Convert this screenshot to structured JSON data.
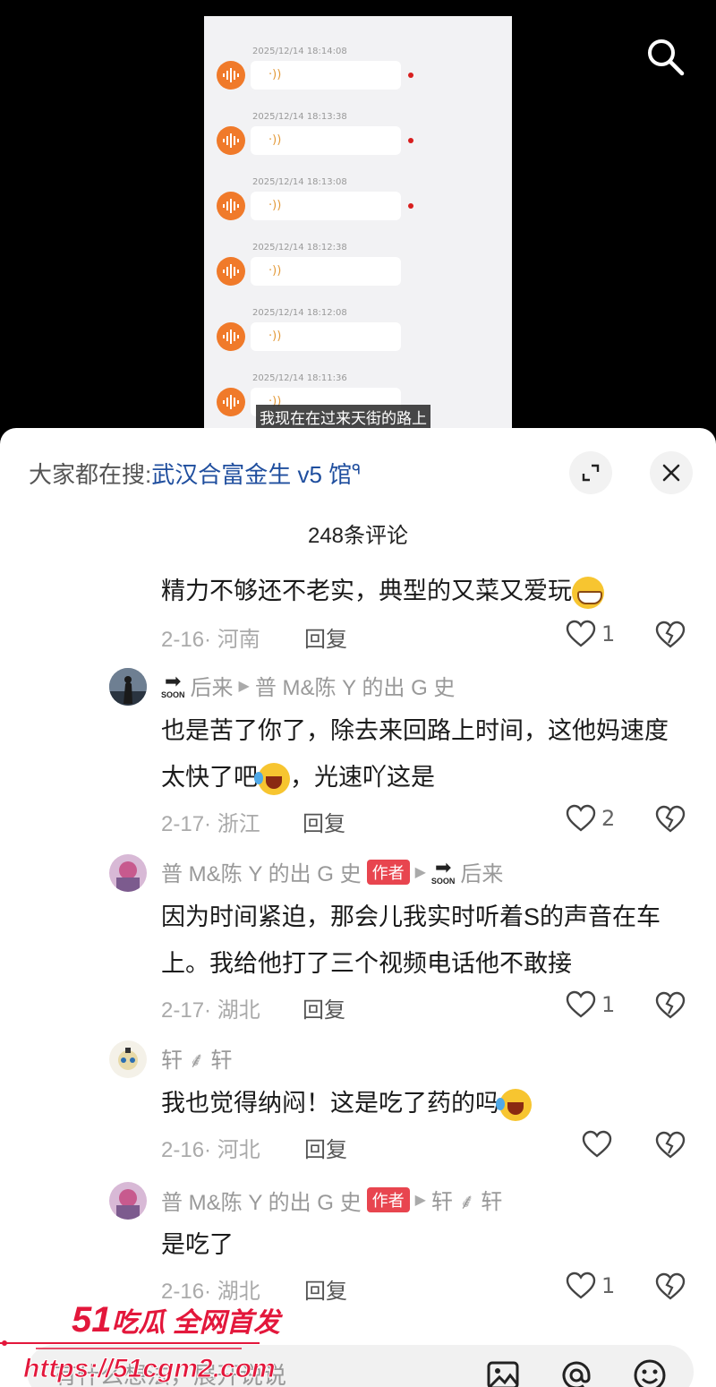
{
  "video": {
    "voice_messages": [
      {
        "time": "2025/12/14 18:14:08",
        "unread": true
      },
      {
        "time": "2025/12/14 18:13:38",
        "unread": true
      },
      {
        "time": "2025/12/14 18:13:08",
        "unread": true
      },
      {
        "time": "2025/12/14 18:12:38",
        "unread": false
      },
      {
        "time": "2025/12/14 18:12:08",
        "unread": false
      },
      {
        "time": "2025/12/14 18:11:36",
        "unread": false
      }
    ],
    "subtitle": "我现在在过来天街的路上",
    "search_icon": "search-icon"
  },
  "sheet": {
    "trending_prefix": "大家都在搜:",
    "trending_link": "武汉合富金生 v5 馆",
    "comment_count": "248条评论"
  },
  "comments": [
    {
      "text": "精力不够还不老实，典型的又菜又爱玩",
      "emoji": "grin",
      "date": "2-16",
      "region": "河南",
      "reply": "回复",
      "likes": "1"
    },
    {
      "author": "后来",
      "reply_to": "普 M&陈 Y 的出 G 史",
      "text": "也是苦了你了，除去来回路上时间，这他妈速度太快了吧",
      "text2": "，光速吖这是",
      "emoji": "laugh",
      "date": "2-17",
      "region": "浙江",
      "reply": "回复",
      "likes": "2",
      "soon_label": "SOON"
    },
    {
      "author": "普 M&陈 Y 的出 G 史",
      "author_badge": "作者",
      "reply_to": "后来",
      "text": "因为时间紧迫，那会儿我实时听着S的声音在车上。我给他打了三个视频电话他不敢接",
      "date": "2-17",
      "region": "湖北",
      "reply": "回复",
      "likes": "1",
      "soon_label": "SOON"
    },
    {
      "author": "轩 ⸙ 轩",
      "text": "我也觉得纳闷！这是吃了药的吗",
      "emoji": "laugh",
      "date": "2-16",
      "region": "河北",
      "reply": "回复",
      "likes": ""
    },
    {
      "author": "普 M&陈 Y 的出 G 史",
      "author_badge": "作者",
      "reply_to": "轩 ⸙ 轩",
      "text": "是吃了",
      "date": "2-16",
      "region": "湖北",
      "reply": "回复",
      "likes": "1"
    }
  ],
  "input": {
    "placeholder": "有什么想法，展开说说"
  },
  "watermark": {
    "line1_num": "51",
    "line1": "吃瓜 全网首发",
    "line2": "https://51cgm2.com"
  }
}
